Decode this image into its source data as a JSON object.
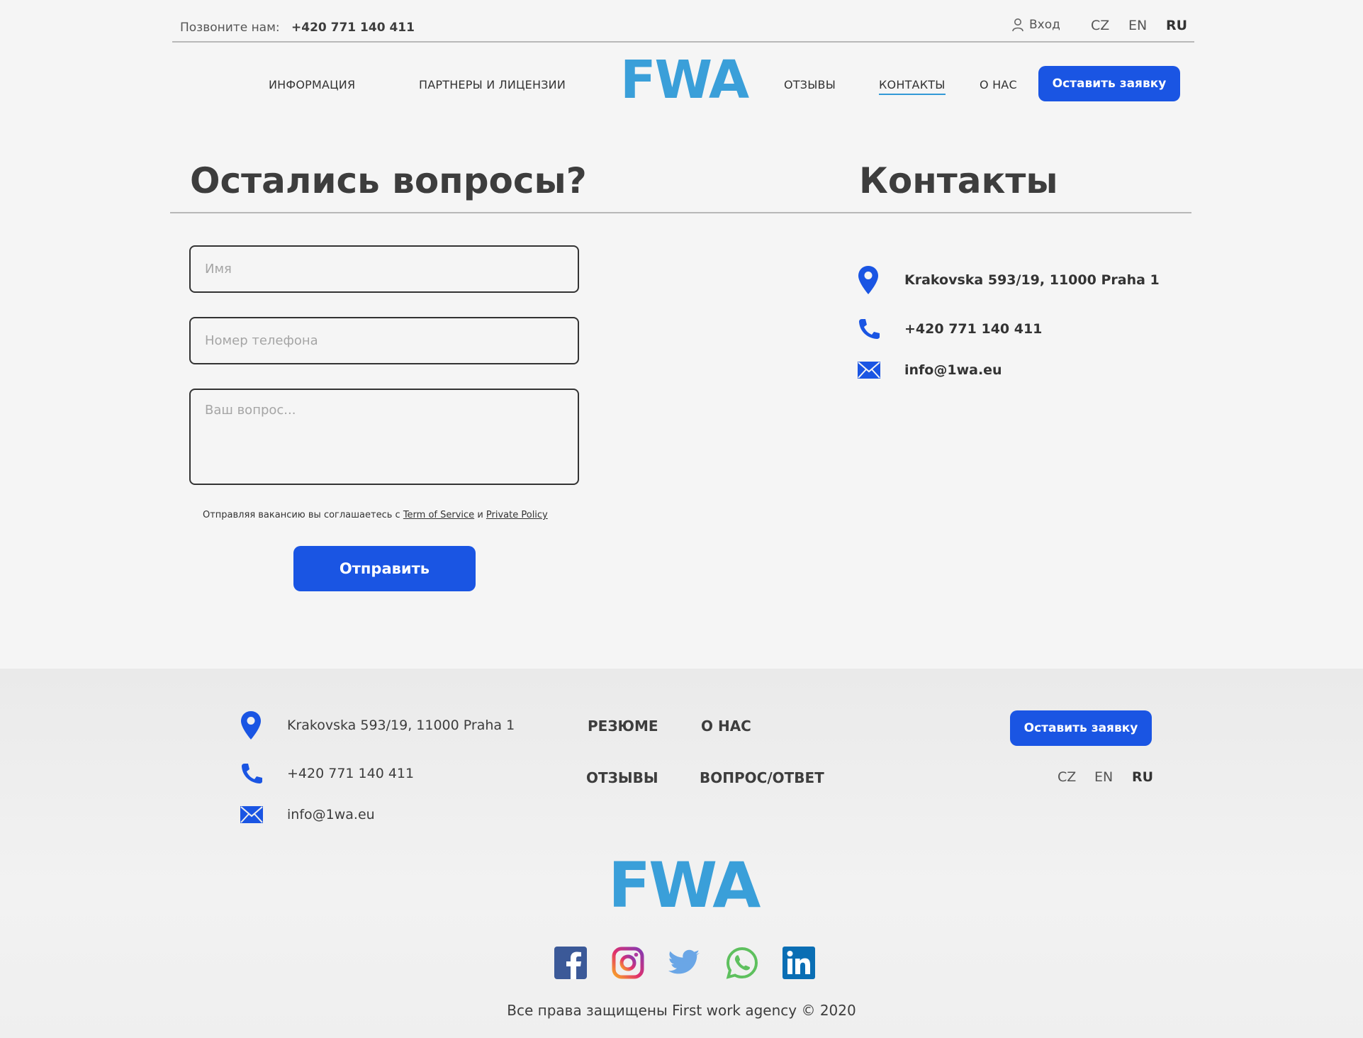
{
  "topbar": {
    "call_label": "Позвоните нам:",
    "phone": "+420 771 140 411",
    "login": "Вход",
    "langs": [
      "CZ",
      "EN",
      "RU"
    ],
    "active_lang": "RU"
  },
  "nav": {
    "items": [
      "ИНФОРМАЦИЯ",
      "ПАРТНЕРЫ И ЛИЦЕНЗИИ",
      "ОТЗЫВЫ",
      "КОНТАКТЫ",
      "О НАС"
    ],
    "active": "КОНТАКТЫ",
    "logo": "FWA",
    "cta": "Оставить заявку"
  },
  "form": {
    "heading": "Остались вопросы?",
    "name_placeholder": "Имя",
    "phone_placeholder": "Номер телефона",
    "question_placeholder": "Ваш вопрос...",
    "consent_prefix": "Отправляя вакансию вы соглашаетесь с",
    "terms_link": "Term of Service",
    "consent_and": "и",
    "privacy_link": "Private Policy",
    "submit": "Отправить"
  },
  "contacts": {
    "heading": "Контакты",
    "address": "Krakovska 593/19, 11000 Praha 1",
    "phone": "+420 771 140 411",
    "email": "info@1wa.eu"
  },
  "footer": {
    "address": "Krakovska 593/19, 11000 Praha 1",
    "phone": "+420 771 140 411",
    "email": "info@1wa.eu",
    "links": [
      "РЕЗЮМЕ",
      "О НАС",
      "ОТЗЫВЫ",
      "ВОПРОС/ОТВЕТ"
    ],
    "cta": "Оставить заявку",
    "langs": [
      "CZ",
      "EN",
      "RU"
    ],
    "active_lang": "RU",
    "logo": "FWA",
    "social": [
      "facebook-icon",
      "instagram-icon",
      "twitter-icon",
      "whatsapp-icon",
      "linkedin-icon"
    ],
    "copyright": "Все права защищены First work agency © 2020"
  },
  "colors": {
    "accent_blue": "#1a55e3",
    "logo_blue": "#3a9fd9",
    "text": "#3d3d3d",
    "background": "#f5f5f5"
  }
}
